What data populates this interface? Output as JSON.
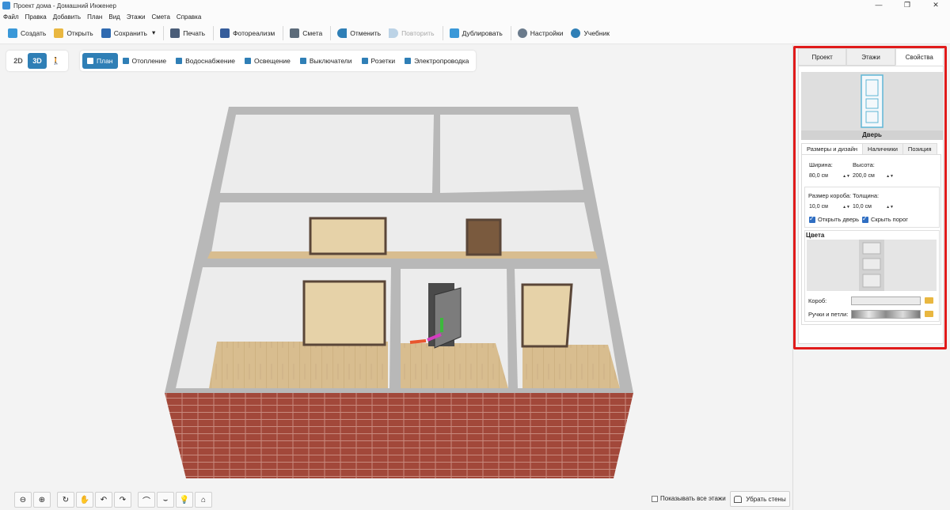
{
  "window": {
    "title": "Проект дома - Домашний Инженер",
    "controls": [
      "—",
      "❐",
      "✕"
    ]
  },
  "menu": [
    "Файл",
    "Правка",
    "Добавить",
    "План",
    "Вид",
    "Этажи",
    "Смета",
    "Справка"
  ],
  "toolbar": {
    "create": "Создать",
    "open": "Открыть",
    "save": "Сохранить",
    "save_dropdown": "▾",
    "print": "Печать",
    "photorealism": "Фотореализм",
    "estimate": "Смета",
    "undo": "Отменить",
    "redo": "Повторить",
    "duplicate": "Дублировать",
    "settings": "Настройки",
    "tutorial": "Учебник"
  },
  "view_toggle": {
    "d2": "2D",
    "d3": "3D",
    "walk": "🚶"
  },
  "mode_tabs": [
    "План",
    "Отопление",
    "Водоснабжение",
    "Освещение",
    "Выключатели",
    "Розетки",
    "Электропроводка"
  ],
  "bottom": {
    "show_all_floors": "Показывать все этажи",
    "remove_walls": "Убрать стены"
  },
  "panel": {
    "tabs": [
      "Проект",
      "Этажи",
      "Свойства"
    ],
    "object_name": "Дверь",
    "subtabs": [
      "Размеры и дизайн",
      "Наличники",
      "Позиция"
    ],
    "width_label": "Ширина:",
    "width_value": "80,0 см",
    "height_label": "Высота:",
    "height_value": "200,0 см",
    "frame_label": "Размер короба:",
    "frame_value": "10,0 см",
    "thickness_label": "Толщина:",
    "thickness_value": "10,0 см",
    "open_door": "Открыть дверь",
    "hide_threshold": "Скрыть порог",
    "colors_title": "Цвета",
    "frame_color_label": "Короб:",
    "handles_label": "Ручки и петли:"
  },
  "colors": {
    "accent": "#2f7fb6",
    "highlight_frame": "#e01b1b",
    "brick": "#a2483a",
    "floor": "#d8bd8f"
  }
}
